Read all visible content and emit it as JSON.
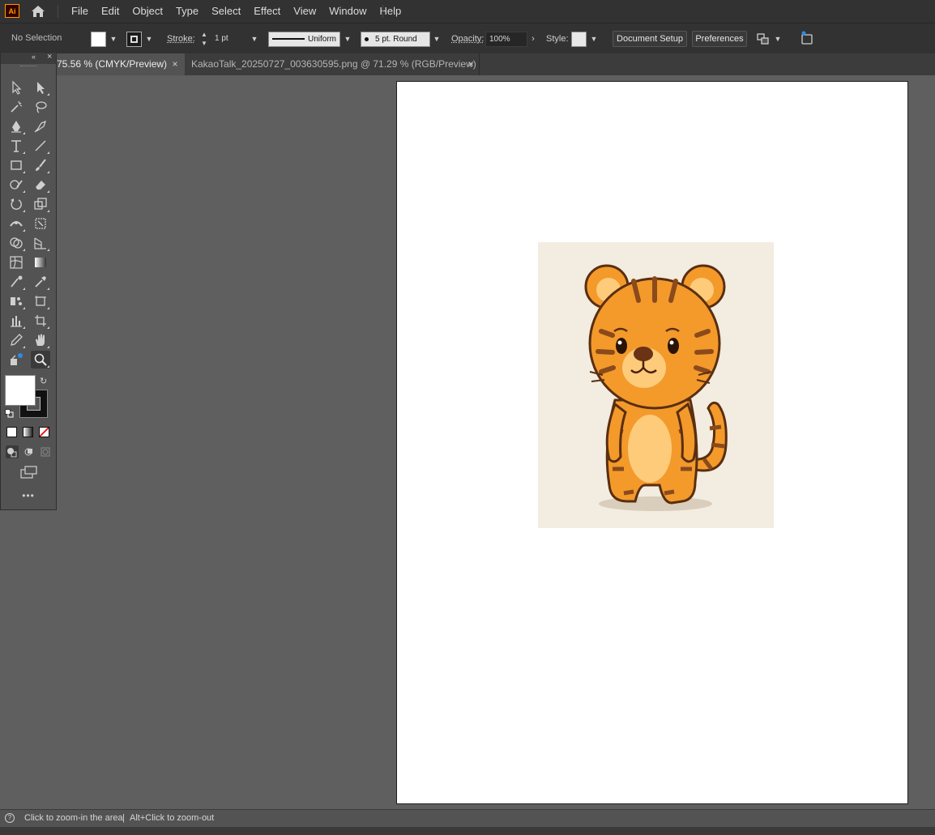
{
  "menubar": {
    "logo": "Ai",
    "items": [
      "File",
      "Edit",
      "Object",
      "Type",
      "Select",
      "Effect",
      "View",
      "Window",
      "Help"
    ]
  },
  "controlbar": {
    "selection": "No Selection",
    "stroke_label": "Stroke:",
    "stroke_weight": "1 pt",
    "stroke_profile": "Uniform",
    "brush": "5 pt. Round",
    "opacity_label": "Opacity:",
    "opacity_value": "100%",
    "style_label": "Style:",
    "document_setup": "Document Setup",
    "preferences": "Preferences"
  },
  "tabs": [
    {
      "label": "75.56 % (CMYK/Preview)",
      "close": "×",
      "active": true
    },
    {
      "label": "KakaoTalk_20250727_003630595.png @ 71.29 % (RGB/Preview)",
      "close": "×",
      "active": false
    }
  ],
  "toolbar": {
    "more": "•••"
  },
  "status": {
    "hint": "Click to zoom-in the area",
    "sep": "|",
    "hint2": "Alt+Click to zoom-out"
  },
  "colors": {
    "chrome_dark": "#323232",
    "panel": "#535353",
    "canvas": "#5f5f5f",
    "tiger_orange": "#f39a2b",
    "tiger_stripe": "#8a4a1b",
    "image_bg": "#f3ece0"
  }
}
